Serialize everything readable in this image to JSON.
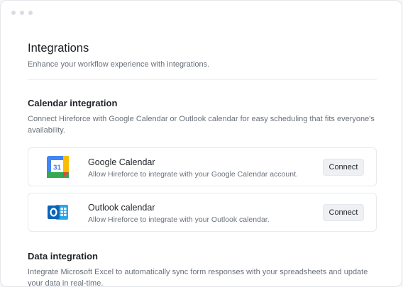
{
  "window": {
    "controls": [
      "dot",
      "dot",
      "dot"
    ]
  },
  "page": {
    "title": "Integrations",
    "subtitle": "Enhance your workflow experience with integrations."
  },
  "calendar_section": {
    "title": "Calendar integration",
    "description": "Connect Hireforce with Google Calendar or Outlook calendar for easy scheduling that fits everyone's availability.",
    "items": [
      {
        "icon": "google-calendar-icon",
        "icon_text": "31",
        "name": "Google Calendar",
        "description": "Allow Hireforce to integrate with your Google Calendar account.",
        "button_label": "Connect"
      },
      {
        "icon": "outlook-calendar-icon",
        "icon_text": "O",
        "name": "Outlook calendar",
        "description": "Allow Hireforce to integrate with your Outlook calendar.",
        "button_label": "Connect"
      }
    ]
  },
  "data_section": {
    "title": "Data integration",
    "description": "Integrate Microsoft Excel to automatically sync form responses with your spreadsheets and update  your data  in real-time."
  },
  "colors": {
    "google_blue": "#4285f4",
    "google_green": "#34a853",
    "google_yellow": "#fbbc04",
    "google_red": "#ea4335",
    "outlook_dark": "#0a64b8",
    "outlook_light": "#28a8ea",
    "button_bg": "#eef0f3"
  }
}
